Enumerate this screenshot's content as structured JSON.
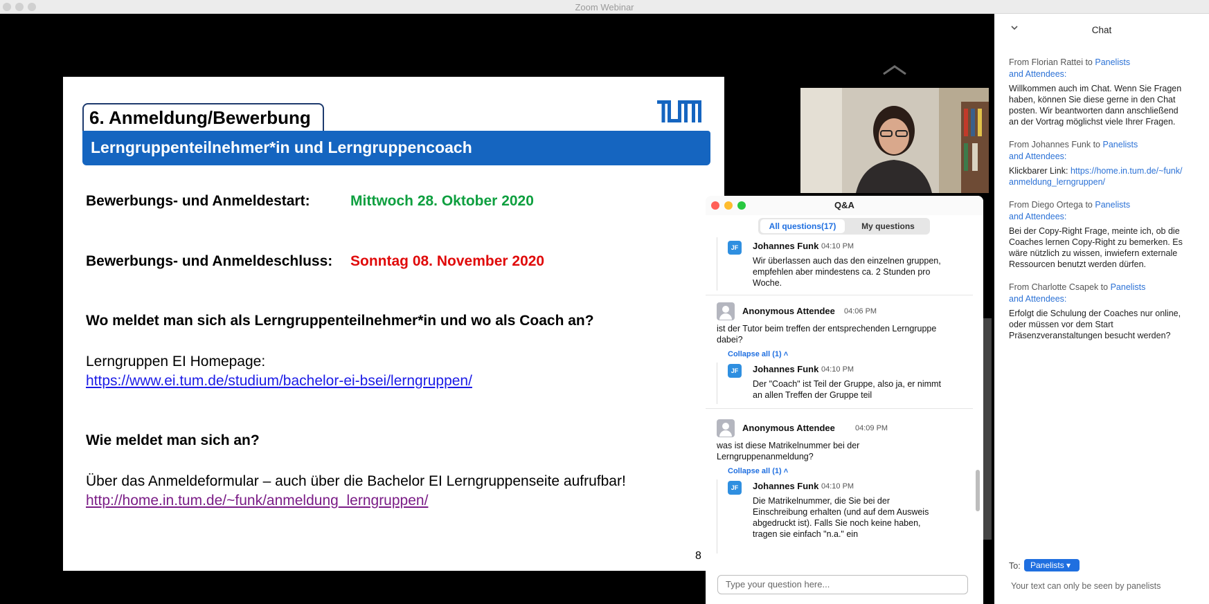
{
  "window": {
    "title": "Zoom Webinar"
  },
  "slide": {
    "title": "6. Anmeldung/Bewerbung",
    "subtitle": "Lerngruppenteilnehmer*in und Lerngruppencoach",
    "start_label": "Bewerbungs- und Anmeldestart:",
    "start_date": "Mittwoch 28. Oktober 2020",
    "end_label": "Bewerbungs- und Anmeldeschluss:",
    "end_date": "Sonntag 08. November 2020",
    "q1": "Wo meldet man sich als Lerngruppenteilnehmer*in und wo als Coach an?",
    "homepage_label": "Lerngruppen EI Homepage:",
    "homepage_url": "https://www.ei.tum.de/studium/bachelor-ei-bsei/lerngruppen/",
    "q2": "Wie meldet man sich an?",
    "form_text": "Über das Anmeldeformular – auch über die Bachelor EI Lerngruppenseite aufrufbar!",
    "form_url": "http://home.in.tum.de/~funk/anmeldung_lerngruppen/",
    "page_number": "8"
  },
  "qa": {
    "title": "Q&A",
    "tab_all": "All questions(17)",
    "tab_mine": "My questions",
    "collapse_label": "Collapse all (1)",
    "items": [
      {
        "reply_initials": "JF",
        "reply_name": "Johannes Funk",
        "reply_time": "04:10 PM",
        "reply_l1": "Wir überlassen auch das den einzelnen gruppen,",
        "reply_l2": "empfehlen aber mindestens ca. 2 Stunden pro",
        "reply_l3": "Woche."
      },
      {
        "name": "Anonymous Attendee",
        "time": "04:06 PM",
        "q_l1": "ist der Tutor beim treffen der entsprechenden Lerngruppe",
        "q_l2": "dabei?",
        "reply_initials": "JF",
        "reply_name": "Johannes Funk",
        "reply_time": "04:10 PM",
        "reply_l1": "Der \"Coach\" ist Teil der Gruppe, also ja, er nimmt",
        "reply_l2": "an allen Treffen der Gruppe teil"
      },
      {
        "name": "Anonymous Attendee",
        "time": "04:09 PM",
        "q_l1": "was ist diese Matrikelnummer bei der",
        "q_l2": "Lerngruppenanmeldung?",
        "reply_initials": "JF",
        "reply_name": "Johannes Funk",
        "reply_time": "04:10 PM",
        "reply_l1": "Die Matrikelnummer, die Sie bei der",
        "reply_l2": "Einschreibung erhalten (und auf dem Ausweis",
        "reply_l3": "abgedruckt ist). Falls Sie noch keine haben,",
        "reply_l4": "tragen sie einfach \"n.a.\" ein"
      }
    ],
    "input_placeholder": "Type your question here..."
  },
  "chat": {
    "title": "Chat",
    "messages": [
      {
        "from_prefix": "From Florian Rattei to",
        "to_l1": "Panelists",
        "to_l2": "and Attendees:",
        "l1": "Willkommen auch im Chat. Wenn Sie Fragen",
        "l2": "haben, können Sie diese gerne in den Chat",
        "l3": "posten. Wir beantworten dann anschließend",
        "l4": "an der Vortrag möglichst viele Ihrer Fragen."
      },
      {
        "from_prefix": "From Johannes Funk to",
        "to_l1": "Panelists",
        "to_l2": "and Attendees:",
        "prefix": "Klickbarer Link:",
        "link_l1": "https://home.in.tum.de/~funk/",
        "link_l2": "anmeldung_lerngruppen/"
      },
      {
        "from_prefix": "From Diego Ortega to",
        "to_l1": "Panelists",
        "to_l2": "and Attendees:",
        "l1": "Bei der Copy-Right Frage, meinte ich, ob die",
        "l2": "Coaches lernen Copy-Right zu bemerken. Es",
        "l3": "wäre nützlich zu wissen, inwiefern externale",
        "l4": "Ressourcen benutzt werden dürfen."
      },
      {
        "from_prefix": "From Charlotte Csapek to",
        "to_l1": "Panelists",
        "to_l2": "and Attendees:",
        "l1": "Erfolgt die Schulung der Coaches nur online,",
        "l2": "oder müssen vor dem Start",
        "l3": "Präsenzveranstaltungen besucht werden?"
      }
    ],
    "to_label": "To:",
    "to_value": "Panelists",
    "note": "Your text can only be seen by panelists"
  },
  "colors": {
    "tum_blue": "#1565c0",
    "start_green": "#0e9f3f",
    "deadline_red": "#e00a0a",
    "accent_blue": "#1f6fe0"
  },
  "icons": {
    "tum_logo": "tum-logo",
    "chat_collapse": "chevron-down-icon",
    "video_collapse": "chevron-up-icon",
    "qa_avatar_anonymous": "user-icon",
    "dropdown": "caret-down-icon"
  }
}
